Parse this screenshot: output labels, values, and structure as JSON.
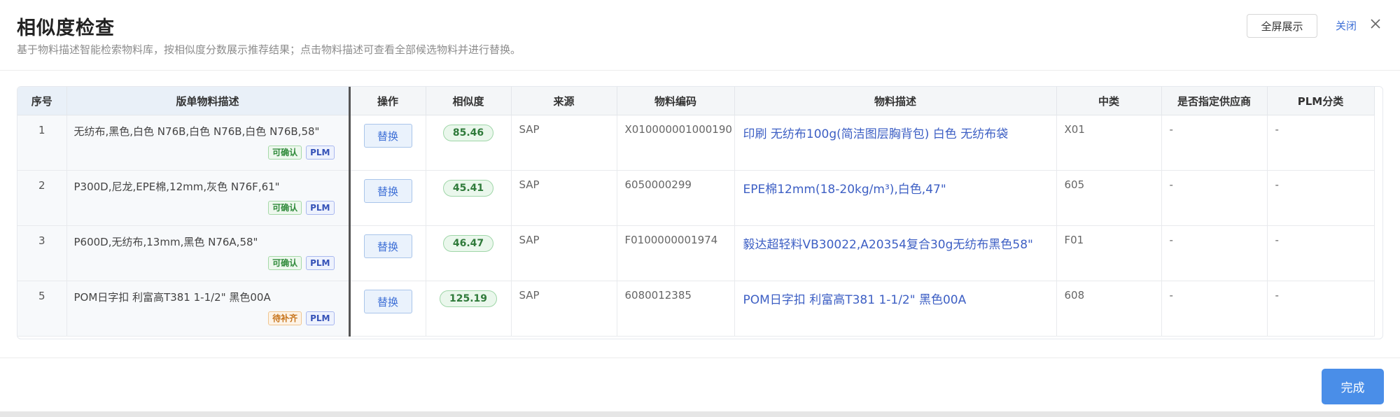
{
  "dialog": {
    "title": "相似度检查",
    "subtitle": "基于物料描述智能检索物料库，按相似度分数展示推荐结果；点击物料描述可查看全部候选物料并进行替换。",
    "fullscreen_label": "全屏展示",
    "close_label": "关闭",
    "done_label": "完成"
  },
  "table": {
    "headers": [
      "序号",
      "版单物料描述",
      "操作",
      "相似度",
      "来源",
      "物料编码",
      "物料描述",
      "中类",
      "是否指定供应商",
      "PLM分类"
    ],
    "rows": [
      {
        "no": "1",
        "bom_desc": "无纺布,黑色,白色 N76B,白色 N76B,白色 N76B,58\"",
        "tag1": "可确认",
        "tag1_type": "ok",
        "tag2": "PLM",
        "action": "替换",
        "score": "85.46",
        "source": "SAP",
        "code": "X010000001000190",
        "material_desc": "印刷 无纺布100g(简洁图层胸背包) 白色 无纺布袋",
        "category": "X01",
        "designated_supplier": "-",
        "plm": "-"
      },
      {
        "no": "2",
        "bom_desc": "P300D,尼龙,EPE棉,12mm,灰色 N76F,61\"",
        "tag1": "可确认",
        "tag1_type": "ok",
        "tag2": "PLM",
        "action": "替换",
        "score": "45.41",
        "source": "SAP",
        "code": "6050000299",
        "material_desc": "EPE棉12mm(18-20kg/m³),白色,47\"",
        "category": "605",
        "designated_supplier": "-",
        "plm": "-"
      },
      {
        "no": "3",
        "bom_desc": "P600D,无纺布,13mm,黑色 N76A,58\"",
        "tag1": "可确认",
        "tag1_type": "ok",
        "tag2": "PLM",
        "action": "替换",
        "score": "46.47",
        "source": "SAP",
        "code": "F0100000001974",
        "material_desc": "毅达超轻料VB30022,A20354复合30g无纺布黑色58\"",
        "category": "F01",
        "designated_supplier": "-",
        "plm": "-"
      },
      {
        "no": "5",
        "bom_desc": "POM日字扣 利富高T381 1-1/2\" 黑色00A",
        "tag1": "待补齐",
        "tag1_type": "pending",
        "tag2": "PLM",
        "action": "替换",
        "score": "125.19",
        "source": "SAP",
        "code": "6080012385",
        "material_desc": "POM日字扣 利富高T381 1-1/2\" 黑色00A",
        "category": "608",
        "designated_supplier": "-",
        "plm": "-"
      }
    ]
  },
  "colors": {
    "accent": "#4a8ee8",
    "link": "#3d5fc4",
    "score_green": "#2f7a3a",
    "tag_pending": "#c7741b",
    "tag_plm": "#3552b8"
  },
  "icons": {
    "close": "close-icon"
  }
}
